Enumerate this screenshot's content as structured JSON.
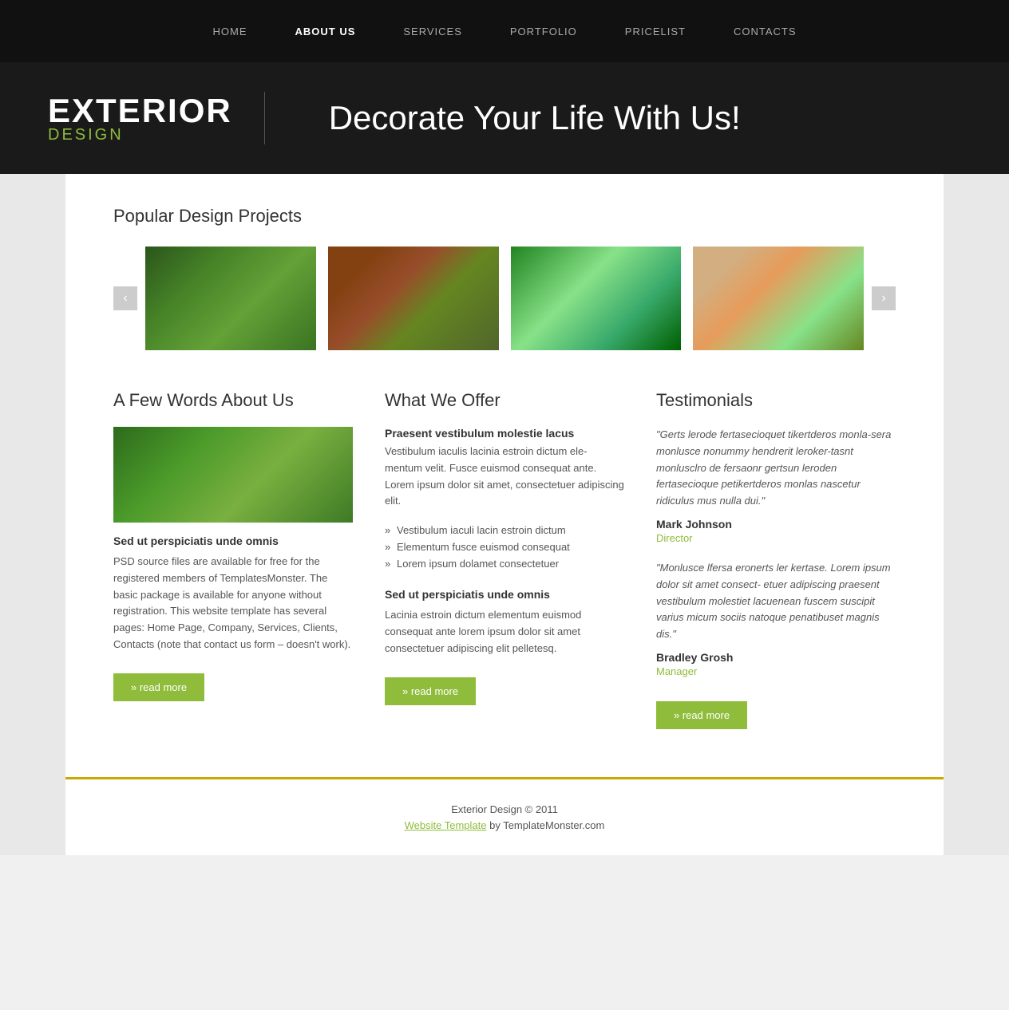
{
  "nav": {
    "items": [
      {
        "label": "HOME",
        "active": false
      },
      {
        "label": "ABOUT US",
        "active": true
      },
      {
        "label": "SERVICES",
        "active": false
      },
      {
        "label": "PORTFOLIO",
        "active": false
      },
      {
        "label": "PRICELIST",
        "active": false
      },
      {
        "label": "CONTACTS",
        "active": false
      }
    ]
  },
  "header": {
    "logo_main": "EXTERIOR",
    "logo_sub": "DESIGN",
    "tagline": "Decorate Your Life With Us!"
  },
  "gallery": {
    "title": "Popular Design Projects",
    "prev_arrow": "‹",
    "next_arrow": "›"
  },
  "about": {
    "title": "A Few Words About Us",
    "subtitle": "Sed ut perspiciatis unde omnis",
    "text": "PSD source files are available for free for the registered members of TemplatesMonster. The basic package is available for anyone without registration. This website template has several pages: Home Page, Company, Services, Clients, Contacts (note that contact us form – doesn't work).",
    "read_more": "» read more"
  },
  "offer": {
    "title": "What We Offer",
    "bold_text": "Praesent vestibulum molestie lacus",
    "intro": "Vestibulum iaculis lacinia estroin dictum ele-mentum velit. Fusce euismod consequat ante. Lorem ipsum dolor sit amet, consectetuer adipiscing elit.",
    "list_items": [
      "Vestibulum iaculi lacin estroin dictum",
      "Elementum fusce euismod consequat",
      "Lorem ipsum dolamet consectetuer"
    ],
    "subtitle2": "Sed ut perspiciatis unde omnis",
    "text2": "Lacinia estroin dictum elementum euismod consequat ante lorem ipsum dolor sit amet consectetuer adipiscing elit pelletesq.",
    "read_more": "» read more"
  },
  "testimonials": {
    "title": "Testimonials",
    "items": [
      {
        "quote": "\"Gerts lerode fertasecioquet tikertderos monla-sera monlusce nonummy hendrerit leroker-tasnt monlusclro de fersaonr gertsun leroden fertasecioque petikertderos monlas nascetur ridiculus mus nulla dui.\"",
        "name": "Mark Johnson",
        "role": "Director"
      },
      {
        "quote": "\"Monlusce lfersa eronerts ler kertase. Lorem ipsum dolor sit amet consect- etuer adipiscing praesent vestibulum molestiet lacuenean fuscem suscipit varius micum sociis natoque penatibuset magnis dis.\"",
        "name": "Bradley Grosh",
        "role": "Manager"
      }
    ],
    "read_more": "» read more"
  },
  "footer": {
    "copy": "Exterior Design © 2011",
    "link_text": "Website Template",
    "suffix": " by TemplateMonster.com"
  }
}
